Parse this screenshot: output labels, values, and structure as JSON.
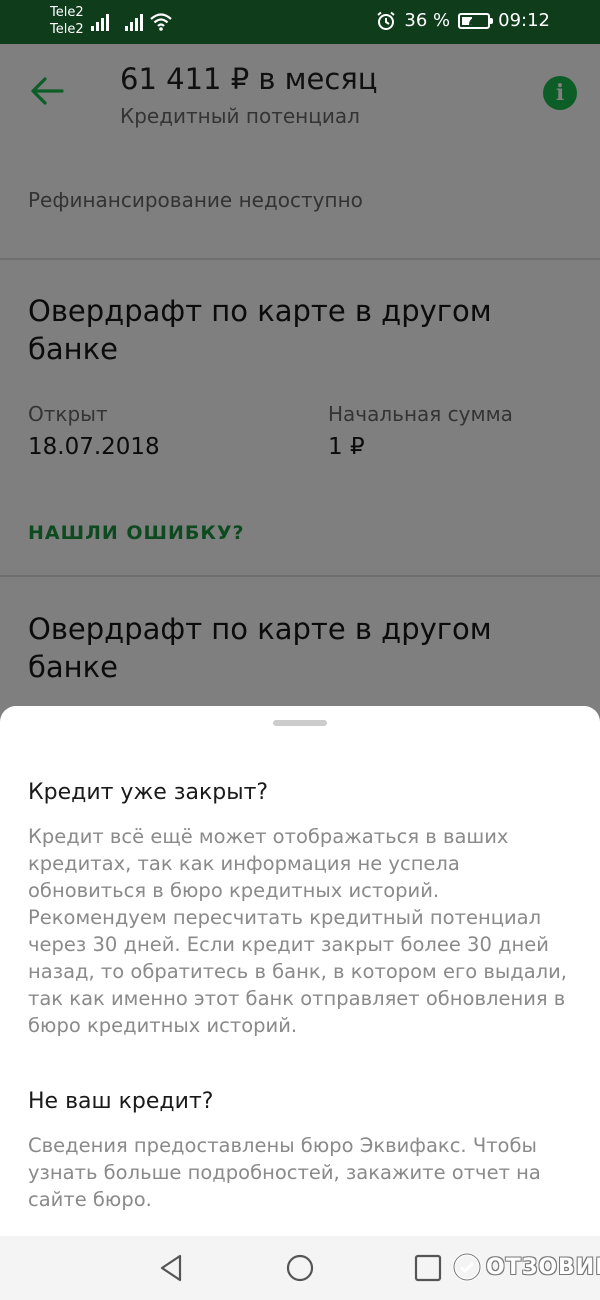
{
  "status_bar": {
    "carrier_1": "Tele2",
    "carrier_2": "Tele2",
    "battery_percent": "36 %",
    "battery_level": 0.36,
    "time": "09:12"
  },
  "header": {
    "title": "61 411 ₽ в месяц",
    "subtitle": "Кредитный потенциал",
    "back_icon": "arrow-left-icon",
    "info_icon": "info-icon",
    "info_glyph": "i"
  },
  "refinancing_text": "Рефинансирование недоступно",
  "credits": [
    {
      "title": "Овердрафт по карте в другом банке",
      "opened_label": "Открыт",
      "opened_value": "18.07.2018",
      "amount_label": "Начальная сумма",
      "amount_value": "1 ₽",
      "error_link": "НАШЛИ ОШИБКУ?"
    },
    {
      "title": "Овердрафт по карте в другом банке"
    }
  ],
  "sheet": {
    "section_1_title": "Кредит уже закрыт?",
    "section_1_text": "Кредит всё ещё может отображаться в ваших кредитах, так как информация не успела обновиться в бюро кредитных историй. Рекомендуем пересчитать кредитный потенциал через 30 дней. Если кредит закрыт более 30 дней назад, то обратитесь в банк, в котором его выдали, так как именно этот банк отправляет обновления в бюро кредитных историй.",
    "section_2_title": "Не ваш кредит?",
    "section_2_text": "Сведения предоставлены бюро Эквифакс. Чтобы узнать больше подробностей, закажите отчет на сайте бюро."
  },
  "watermark": {
    "text": "ОТЗОВИК"
  },
  "colors": {
    "status_bar": "#0f3d1c",
    "accent_green": "#0d5d26",
    "scrim": "#7f7f7f",
    "sheet": "#ffffff"
  }
}
